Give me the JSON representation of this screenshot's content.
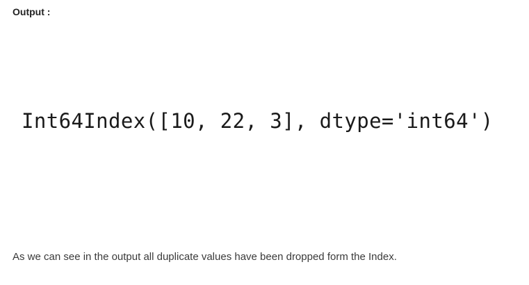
{
  "heading": "Output :",
  "code_output": "Int64Index([10, 22, 3], dtype='int64')",
  "paragraph": "As we can see in the output all duplicate values have been dropped form the Index.",
  "colors": {
    "background": "#ffffff",
    "heading_text": "#222222",
    "code_text": "#1a1a1a",
    "body_text": "#3a3a3a"
  }
}
